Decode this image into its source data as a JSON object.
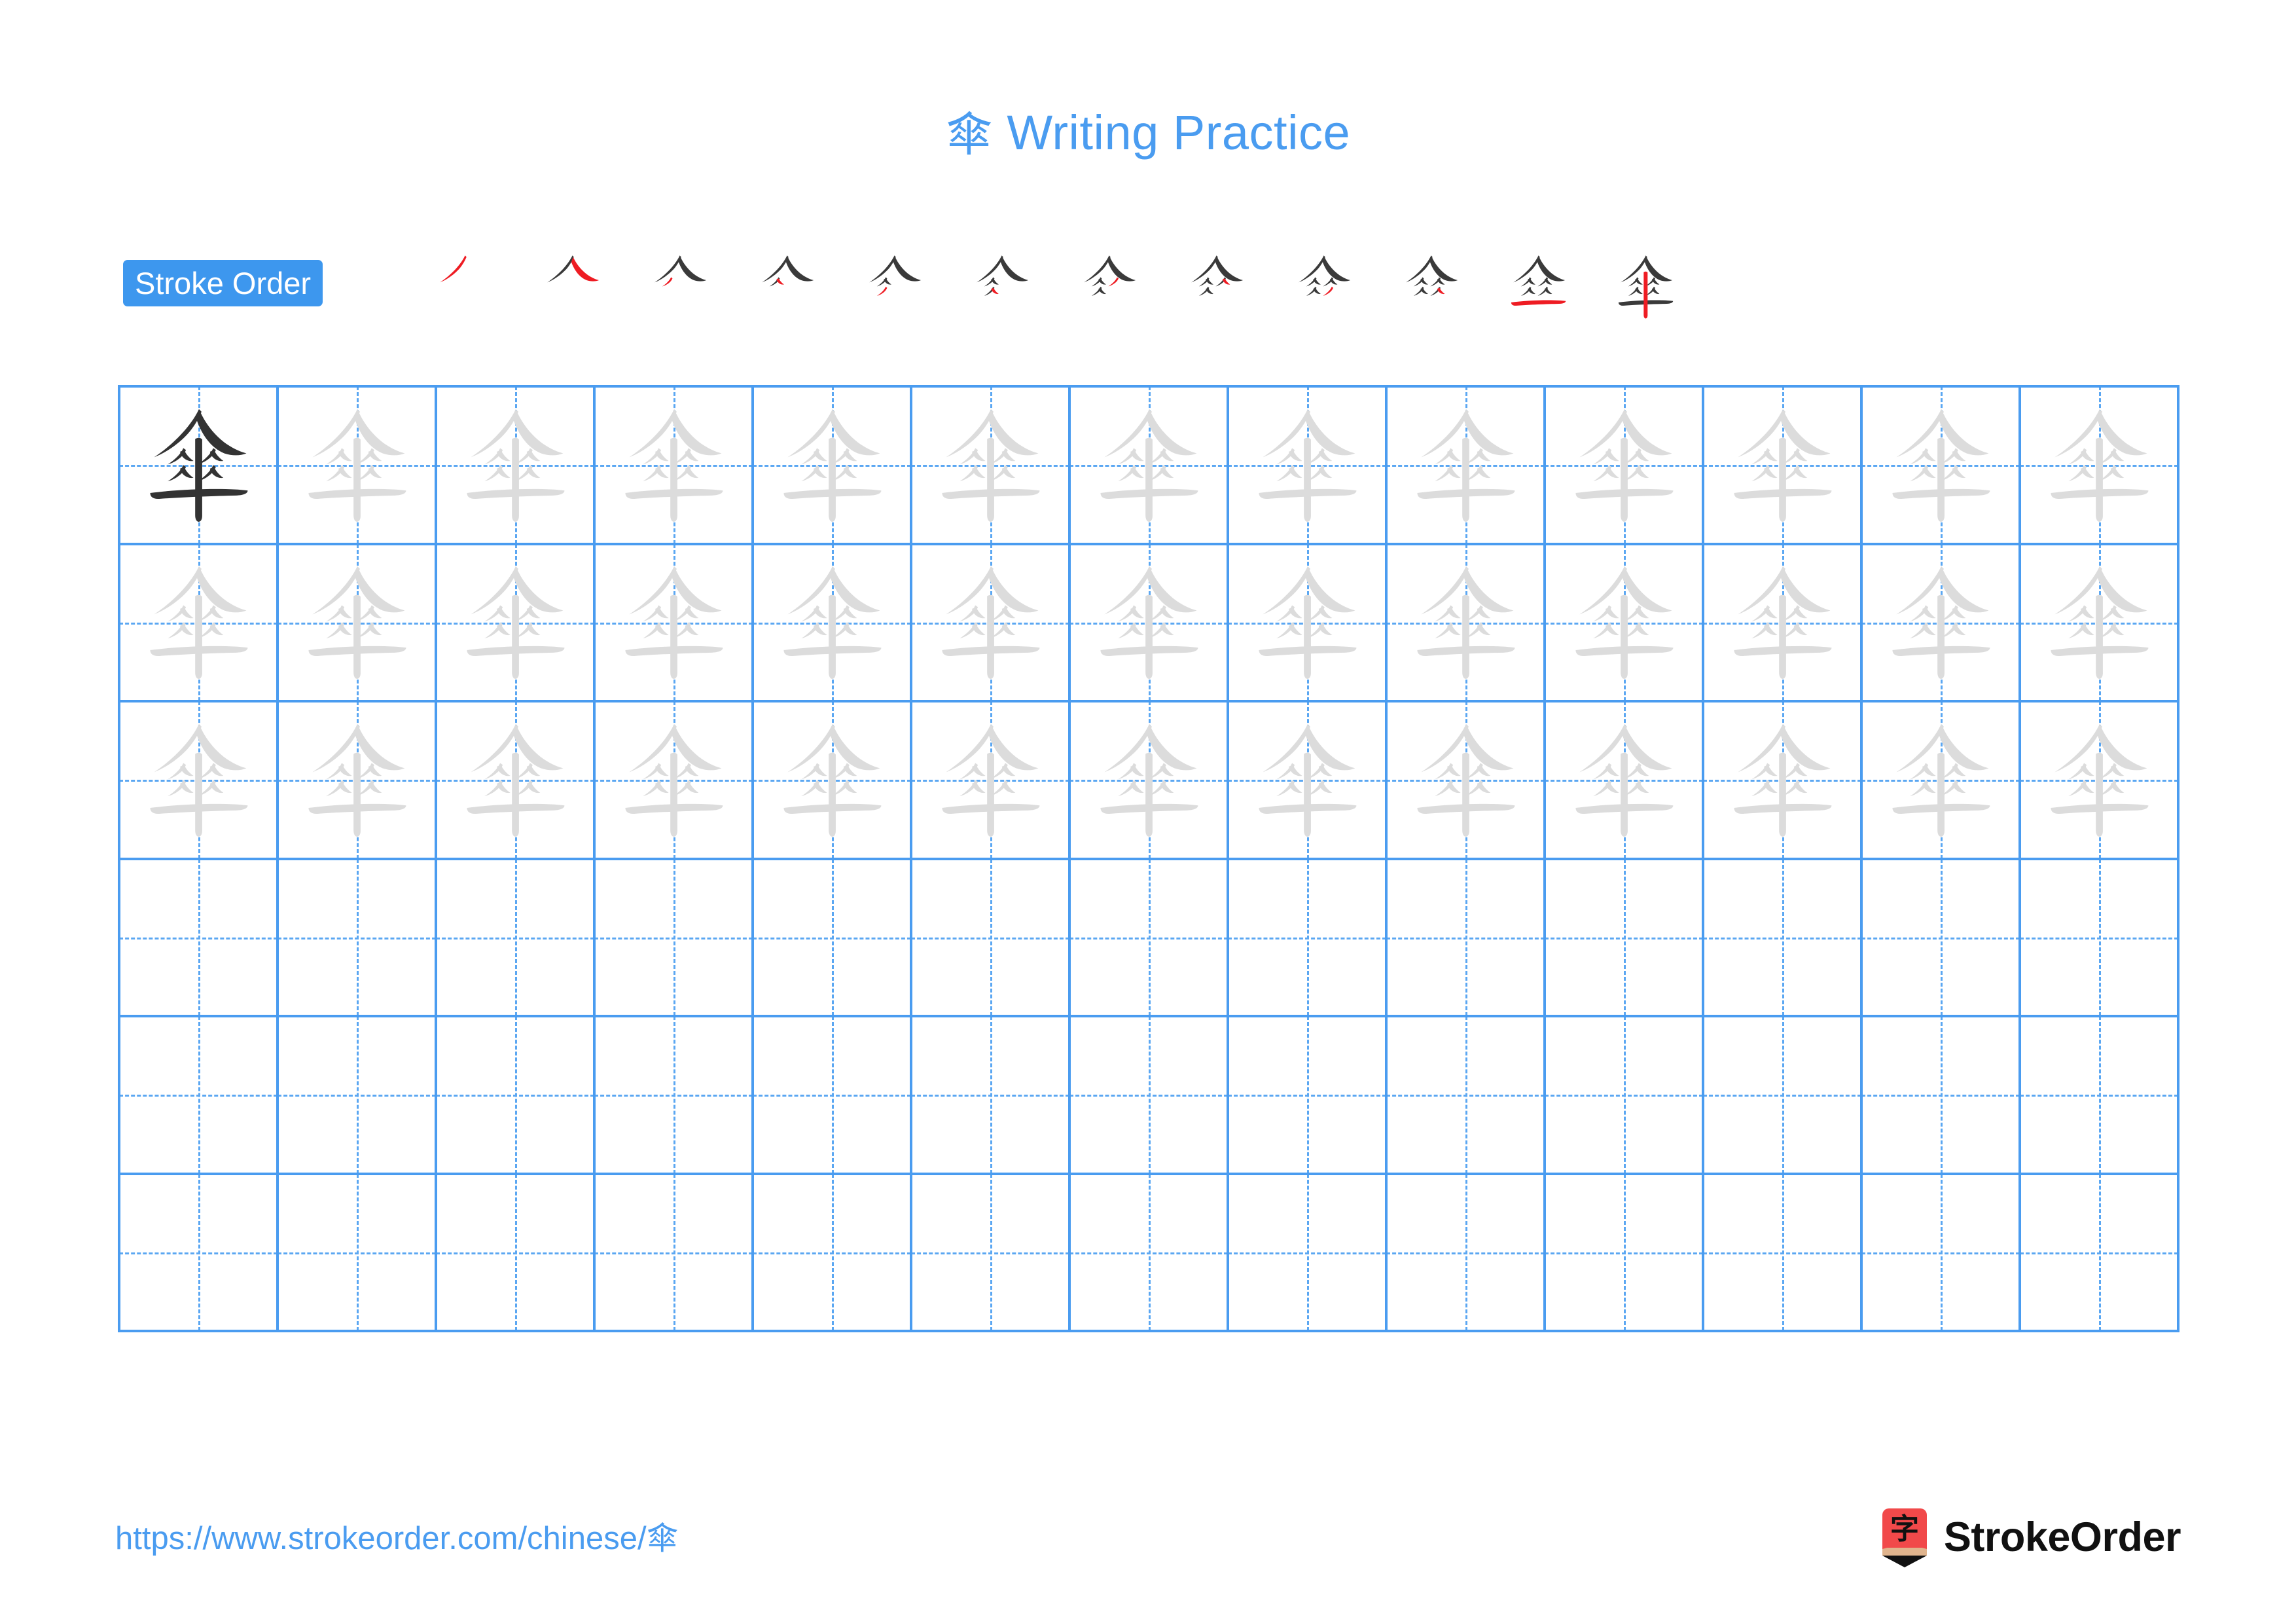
{
  "page": {
    "character": "傘",
    "title_suffix": " Writing Practice",
    "title_full": "傘 Writing Practice",
    "background_color": "#ffffff"
  },
  "colors": {
    "accent_blue": "#4A9CF0",
    "badge_blue": "#3D97EE",
    "grid_line_blue": "#4A9CF0",
    "guide_dash_blue": "#5BA7F2",
    "stroke_dark": "#3A3A3A",
    "stroke_new_red": "#EE1C23",
    "trace_gray": "#DCDCDC",
    "model_char_dark": "#333333",
    "logo_red": "#F1494A",
    "logo_wood": "#E0B48D",
    "brand_text": "#111111"
  },
  "stroke_order": {
    "badge_label": "Stroke Order",
    "total_strokes": 12,
    "steps": [
      {
        "index": 1,
        "new_stroke_name": "pie"
      },
      {
        "index": 2,
        "new_stroke_name": "na"
      },
      {
        "index": 3,
        "new_stroke_name": "pie"
      },
      {
        "index": 4,
        "new_stroke_name": "na"
      },
      {
        "index": 5,
        "new_stroke_name": "pie"
      },
      {
        "index": 6,
        "new_stroke_name": "na"
      },
      {
        "index": 7,
        "new_stroke_name": "pie"
      },
      {
        "index": 8,
        "new_stroke_name": "na"
      },
      {
        "index": 9,
        "new_stroke_name": "pie"
      },
      {
        "index": 10,
        "new_stroke_name": "na"
      },
      {
        "index": 11,
        "new_stroke_name": "heng"
      },
      {
        "index": 12,
        "new_stroke_name": "shu"
      }
    ]
  },
  "practice_grid": {
    "columns": 13,
    "rows": 6,
    "cells": [
      [
        "model",
        "trace",
        "trace",
        "trace",
        "trace",
        "trace",
        "trace",
        "trace",
        "trace",
        "trace",
        "trace",
        "trace",
        "trace"
      ],
      [
        "trace",
        "trace",
        "trace",
        "trace",
        "trace",
        "trace",
        "trace",
        "trace",
        "trace",
        "trace",
        "trace",
        "trace",
        "trace"
      ],
      [
        "trace",
        "trace",
        "trace",
        "trace",
        "trace",
        "trace",
        "trace",
        "trace",
        "trace",
        "trace",
        "trace",
        "trace",
        "trace"
      ],
      [
        "empty",
        "empty",
        "empty",
        "empty",
        "empty",
        "empty",
        "empty",
        "empty",
        "empty",
        "empty",
        "empty",
        "empty",
        "empty"
      ],
      [
        "empty",
        "empty",
        "empty",
        "empty",
        "empty",
        "empty",
        "empty",
        "empty",
        "empty",
        "empty",
        "empty",
        "empty",
        "empty"
      ],
      [
        "empty",
        "empty",
        "empty",
        "empty",
        "empty",
        "empty",
        "empty",
        "empty",
        "empty",
        "empty",
        "empty",
        "empty",
        "empty"
      ]
    ]
  },
  "footer": {
    "url": "https://www.strokeorder.com/chinese/傘",
    "brand_name": "StrokeOrder",
    "brand_logo_glyph": "字"
  }
}
